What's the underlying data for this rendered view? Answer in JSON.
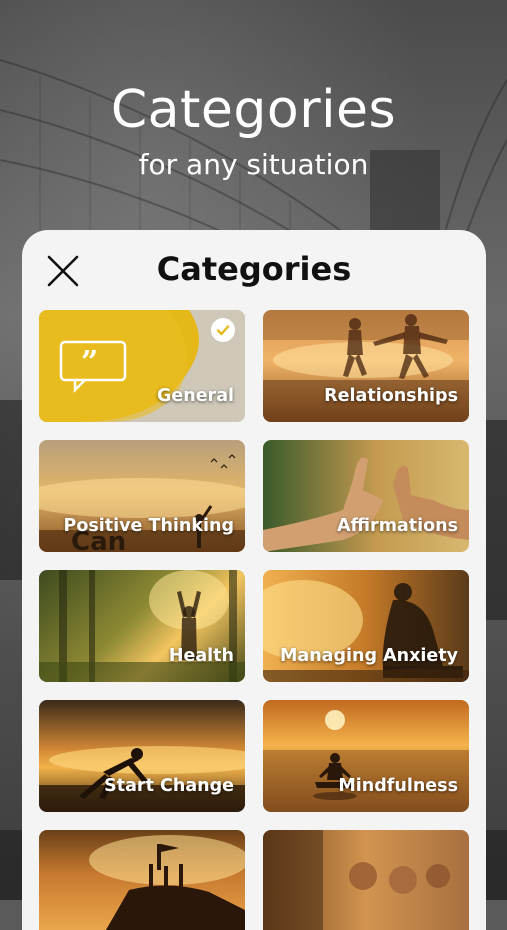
{
  "hero": {
    "title": "Categories",
    "subtitle": "for any situation"
  },
  "sheet": {
    "title": "Categories",
    "close_icon": "close-icon"
  },
  "categories": [
    {
      "label": "General",
      "selected": true
    },
    {
      "label": "Relationships",
      "selected": false
    },
    {
      "label": "Positive Thinking",
      "selected": false
    },
    {
      "label": "Affirmations",
      "selected": false
    },
    {
      "label": "Health",
      "selected": false
    },
    {
      "label": "Managing Anxiety",
      "selected": false
    },
    {
      "label": "Start Change",
      "selected": false
    },
    {
      "label": "Mindfulness",
      "selected": false
    },
    {
      "label": "",
      "selected": false
    },
    {
      "label": "",
      "selected": false
    }
  ],
  "colors": {
    "sheet_bg": "#f4f4f4",
    "general_accent": "#e5b81a",
    "check_mark": "#e5b81a"
  }
}
